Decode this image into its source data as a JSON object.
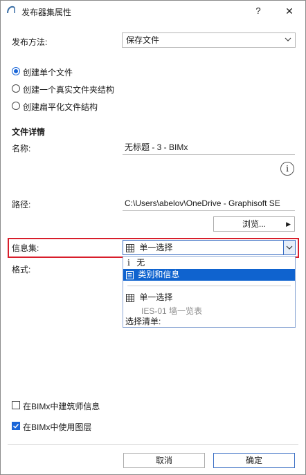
{
  "window": {
    "title": "发布器集属性",
    "help": "?",
    "close": "✕"
  },
  "publish_method": {
    "label": "发布方法:",
    "value": "保存文件"
  },
  "structure_options": [
    {
      "label": "创建单个文件",
      "checked": true
    },
    {
      "label": "创建一个真实文件夹结构",
      "checked": false
    },
    {
      "label": "创建扁平化文件结构",
      "checked": false
    }
  ],
  "file_details": {
    "heading": "文件详情",
    "name_label": "名称:",
    "name_value": "无标题 - 3 - BIMx",
    "info_glyph": "i",
    "path_label": "路径:",
    "path_value": "C:\\Users\\abelov\\OneDrive - Graphisoft SE",
    "browse_label": "浏览..."
  },
  "info_set": {
    "label": "信息集:",
    "value": "单一选择",
    "format_label": "格式:",
    "dropdown": {
      "none_glyph": "i",
      "none_label": "无",
      "selected_label": "类别和信息",
      "single_label": "单一选择",
      "sub_label": "IES-01 墙一览表",
      "list_label": "选择清单:"
    }
  },
  "options": [
    {
      "label": "在BIMx中建筑师信息",
      "checked": false
    },
    {
      "label": "在BIMx中使用图层",
      "checked": true
    }
  ],
  "footer": {
    "cancel": "取消",
    "ok": "确定"
  },
  "colors": {
    "accent": "#1a66d8",
    "highlight": "#d81e2b",
    "selected_bg": "#0f63cf"
  }
}
